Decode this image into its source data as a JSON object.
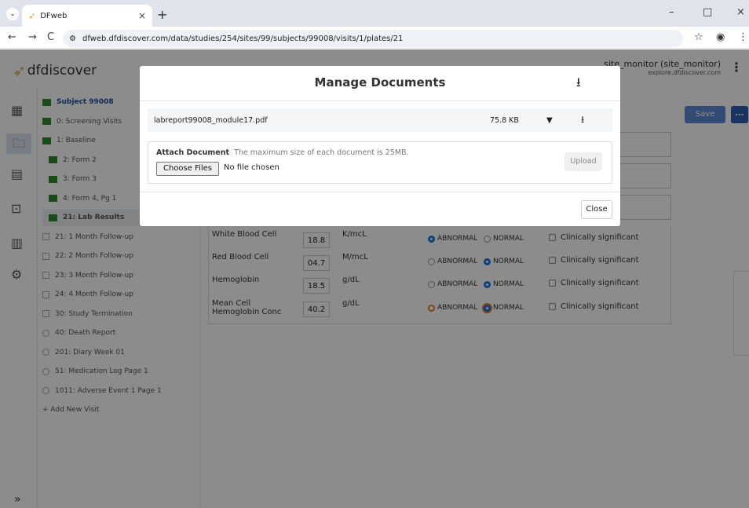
{
  "browser": {
    "tab_title": "DFweb",
    "tab_close": "×",
    "new_tab": "+",
    "url": "dfweb.dfdiscover.com/data/studies/254/sites/99/subjects/99008/visits/1/plates/21",
    "controls": {
      "minimize": "–",
      "maximize": "□",
      "close": "×"
    },
    "nav": {
      "back": "←",
      "forward": "→",
      "reload": "C"
    }
  },
  "app": {
    "logo_text": "dfdiscover",
    "user_name": "site_monitor (site_monitor)",
    "user_host": "explore.dfdiscover.com",
    "kebab": "⋮",
    "save_label": "Save",
    "more_label": "…",
    "expand_label": "»"
  },
  "tree": [
    {
      "label": "Subject 99008",
      "state": "subject"
    },
    {
      "label": "0: Screening Visits",
      "state": "done"
    },
    {
      "label": "1: Baseline",
      "state": "done"
    },
    {
      "label": "2: Form 2",
      "state": "done",
      "indent": true
    },
    {
      "label": "3: Form 3",
      "state": "done",
      "indent": true
    },
    {
      "label": "4: Form 4, Pg 1",
      "state": "done",
      "indent": true
    },
    {
      "label": "21: Lab Results",
      "state": "done",
      "indent": true,
      "selected": true
    },
    {
      "label": "21: 1 Month Follow-up",
      "state": "empty"
    },
    {
      "label": "22: 2 Month Follow-up",
      "state": "empty"
    },
    {
      "label": "23: 3 Month Follow-up",
      "state": "empty"
    },
    {
      "label": "24: 4 Month Follow-up",
      "state": "empty"
    },
    {
      "label": "30: Study Termination",
      "state": "empty"
    },
    {
      "label": "40: Death Report",
      "state": "circle"
    },
    {
      "label": "201: Diary Week 01",
      "state": "circle"
    },
    {
      "label": "51: Medication Log Page 1",
      "state": "circle"
    },
    {
      "label": "1011: Adverse Event 1 Page 1",
      "state": "circle"
    },
    {
      "label": "+ Add New Visit",
      "state": "add"
    }
  ],
  "labs": [
    {
      "name": "White Blood Cell",
      "value": "18.8",
      "unit": "K/mcL",
      "abnormal": true,
      "normal": false,
      "sig": "Clinically significant"
    },
    {
      "name": "Red Blood Cell",
      "value": "04.7",
      "unit": "M/mcL",
      "abnormal": false,
      "normal": true,
      "sig": "Clinically significant"
    },
    {
      "name": "Hemoglobin",
      "value": "18.5",
      "unit": "g/dL",
      "abnormal": false,
      "normal": true,
      "sig": "Clinically significant"
    },
    {
      "name": "Mean Cell Hemoglobin Conc",
      "value": "40.2",
      "unit": "g/dL",
      "abnormal": false,
      "normal": true,
      "sig": "Clinically significant",
      "focus": true
    }
  ],
  "radio_labels": {
    "abnormal": "ABNORMAL",
    "normal": "NORMAL"
  },
  "modal": {
    "title": "Manage Documents",
    "document": {
      "name": "labreport99008_module17.pdf",
      "size": "75.8 KB"
    },
    "attach_label": "Attach Document",
    "attach_note": "The maximum size of each document is 25MB.",
    "choose_label": "Choose Files",
    "no_file": "No file chosen",
    "upload_label": "Upload",
    "close_label": "Close"
  }
}
